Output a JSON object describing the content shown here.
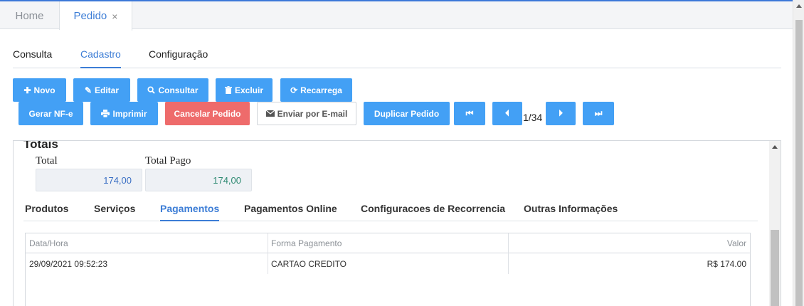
{
  "top_tabs": {
    "home": "Home",
    "pedido": "Pedido",
    "close": "×"
  },
  "sub_tabs": [
    "Consulta",
    "Cadastro",
    "Configuração"
  ],
  "toolbar": {
    "novo": "Novo",
    "editar": "Editar",
    "consultar": "Consultar",
    "excluir": "Excluir",
    "recarrega": "Recarrega",
    "gerar_nfe": "Gerar NF-e",
    "imprimir": "Imprimir",
    "cancelar": "Cancelar Pedido",
    "enviar_email": "Enviar por E-mail",
    "duplicar": "Duplicar Pedido",
    "pager": "1/34"
  },
  "totais": {
    "title": "Totais",
    "total_label": "Total",
    "total_value": "174,00",
    "pago_label": "Total Pago",
    "pago_value": "174,00"
  },
  "inner_tabs": [
    "Produtos",
    "Serviços",
    "Pagamentos",
    "Pagamentos Online",
    "Configuracoes de Recorrencia",
    "Outras Informações"
  ],
  "grid": {
    "headers": [
      "Data/Hora",
      "Forma Pagamento",
      "Valor"
    ],
    "rows": [
      [
        "29/09/2021 09:52:23",
        "CARTAO CREDITO",
        "R$ 174.00"
      ]
    ]
  },
  "colors": {
    "accent": "#43a0f5",
    "danger": "#ee6b6b",
    "active_tab": "#3c7dd6"
  }
}
